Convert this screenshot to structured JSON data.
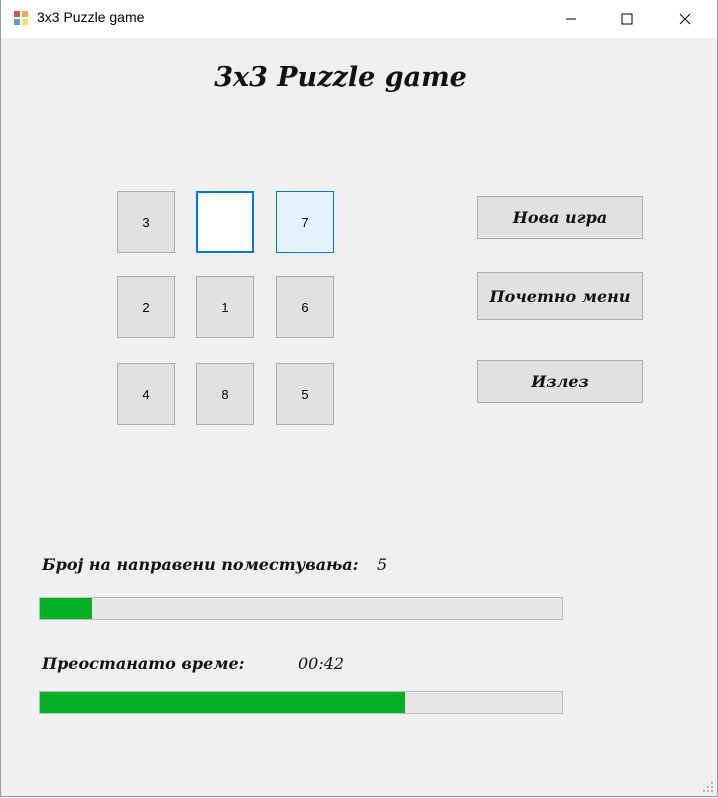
{
  "window": {
    "title": "3x3 Puzzle game"
  },
  "heading": "3x3 Puzzle game",
  "tiles": [
    {
      "label": "3",
      "state": "normal"
    },
    {
      "label": "",
      "state": "empty"
    },
    {
      "label": "7",
      "state": "hover"
    },
    {
      "label": "2",
      "state": "normal"
    },
    {
      "label": "1",
      "state": "normal"
    },
    {
      "label": "6",
      "state": "normal"
    },
    {
      "label": "4",
      "state": "normal"
    },
    {
      "label": "8",
      "state": "normal"
    },
    {
      "label": "5",
      "state": "normal"
    }
  ],
  "buttons": {
    "new_game": "Нова игра",
    "main_menu": "Почетно мени",
    "exit": "Излез"
  },
  "moves": {
    "label": "Број на направени поместувања:",
    "value": "5",
    "progress_percent": 10
  },
  "time": {
    "label": "Преостанато време:",
    "value": "00:42",
    "progress_percent": 70
  },
  "colors": {
    "progress": "#06b025",
    "focus": "#0078d7",
    "window_bg": "#f0f0f0"
  }
}
